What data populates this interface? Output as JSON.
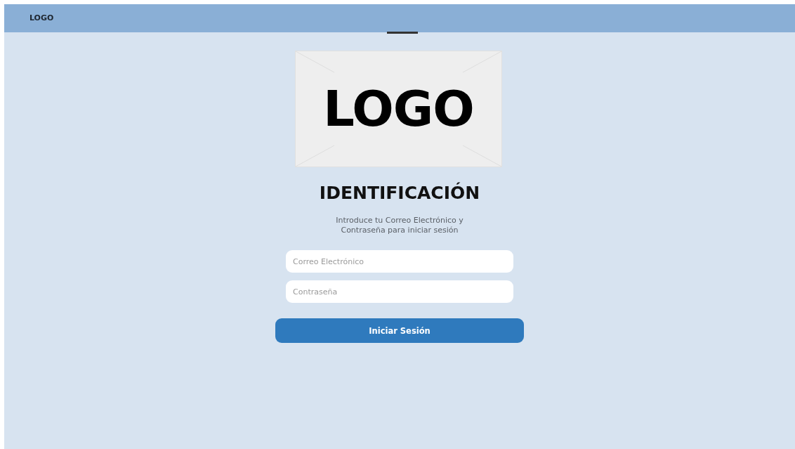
{
  "header": {
    "brand": "LOGO"
  },
  "logo_placeholder": {
    "text": "LOGO"
  },
  "title": "IDENTIFICACIÓN",
  "subtitle": "Introduce tu Correo Electrónico y\nContraseña para iniciar sesión",
  "fields": [
    {
      "placeholder": "Correo Electrónico"
    },
    {
      "placeholder": "Contraseña"
    }
  ],
  "submit_button": "Iniciar Sesión"
}
